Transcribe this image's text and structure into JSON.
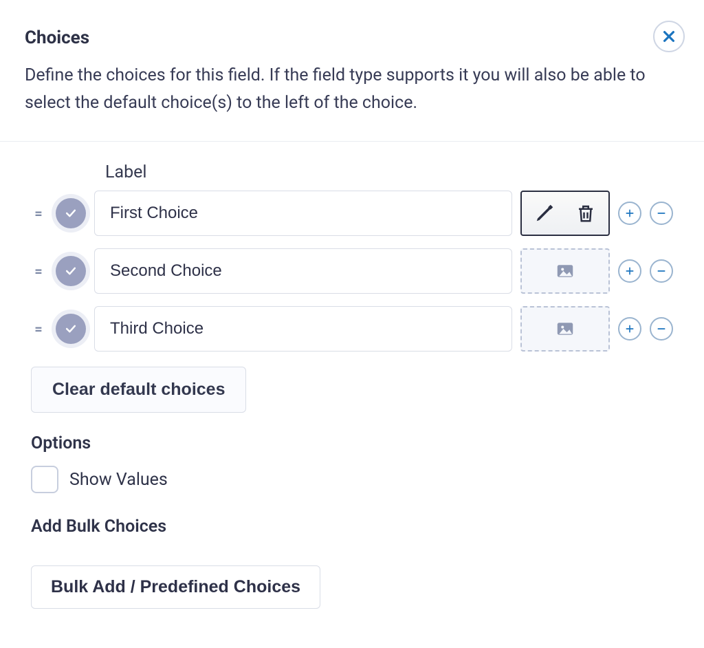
{
  "header": {
    "title": "Choices",
    "description": "Define the choices for this field. If the field type supports it you will also be able to select the default choice(s) to the left of the choice."
  },
  "label_heading": "Label",
  "choices": [
    {
      "label": "First Choice",
      "has_image_editor": true
    },
    {
      "label": "Second Choice",
      "has_image_editor": false
    },
    {
      "label": "Third Choice",
      "has_image_editor": false
    }
  ],
  "buttons": {
    "clear_defaults": "Clear default choices",
    "bulk_add": "Bulk Add / Predefined Choices"
  },
  "options": {
    "heading": "Options",
    "show_values_label": "Show Values",
    "show_values_checked": false
  },
  "bulk": {
    "heading": "Add Bulk Choices"
  },
  "colors": {
    "accent_blue": "#1b74bf"
  }
}
